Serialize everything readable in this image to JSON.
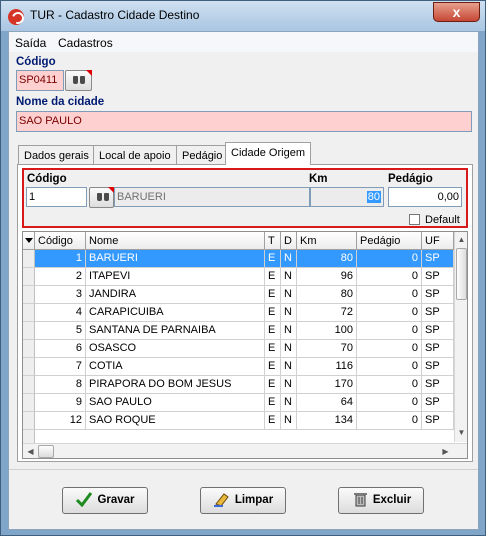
{
  "window": {
    "title": "TUR - Cadastro Cidade Destino",
    "close_glyph": "x"
  },
  "menu": {
    "items": [
      "Saída",
      "Cadastros"
    ]
  },
  "codigo": {
    "label": "Código",
    "value": "SP0411"
  },
  "nome": {
    "label": "Nome da cidade",
    "value": "SAO PAULO"
  },
  "tabs": [
    "Dados gerais",
    "Local de apoio",
    "Pedágio",
    "Cidade Origem"
  ],
  "origem": {
    "codigo_label": "Código",
    "codigo_value": "1",
    "cidade_value": "BARUERI",
    "km_label": "Km",
    "km_value": "80",
    "pedagio_label": "Pedágio",
    "pedagio_value": "0,00",
    "default_label": "Default"
  },
  "grid": {
    "columns": [
      "Código",
      "Nome",
      "T",
      "D",
      "Km",
      "Pedágio",
      "UF"
    ],
    "rows": [
      [
        "1",
        "BARUERI",
        "E",
        "N",
        "80",
        "0",
        "SP"
      ],
      [
        "2",
        "ITAPEVI",
        "E",
        "N",
        "96",
        "0",
        "SP"
      ],
      [
        "3",
        "JANDIRA",
        "E",
        "N",
        "80",
        "0",
        "SP"
      ],
      [
        "4",
        "CARAPICUIBA",
        "E",
        "N",
        "72",
        "0",
        "SP"
      ],
      [
        "5",
        "SANTANA DE PARNAIBA",
        "E",
        "N",
        "100",
        "0",
        "SP"
      ],
      [
        "6",
        "OSASCO",
        "E",
        "N",
        "70",
        "0",
        "SP"
      ],
      [
        "7",
        "COTIA",
        "E",
        "N",
        "116",
        "0",
        "SP"
      ],
      [
        "8",
        "PIRAPORA DO BOM JESUS",
        "E",
        "N",
        "170",
        "0",
        "SP"
      ],
      [
        "9",
        "SAO PAULO",
        "E",
        "N",
        "64",
        "0",
        "SP"
      ],
      [
        "12",
        "SAO ROQUE",
        "E",
        "N",
        "134",
        "0",
        "SP"
      ]
    ]
  },
  "buttons": {
    "gravar": "Gravar",
    "limpar": "Limpar",
    "excluir": "Excluir"
  },
  "colors": {
    "selection": "#3399ff",
    "required_field": "#ffd0d0",
    "highlight_border": "#d71919"
  }
}
